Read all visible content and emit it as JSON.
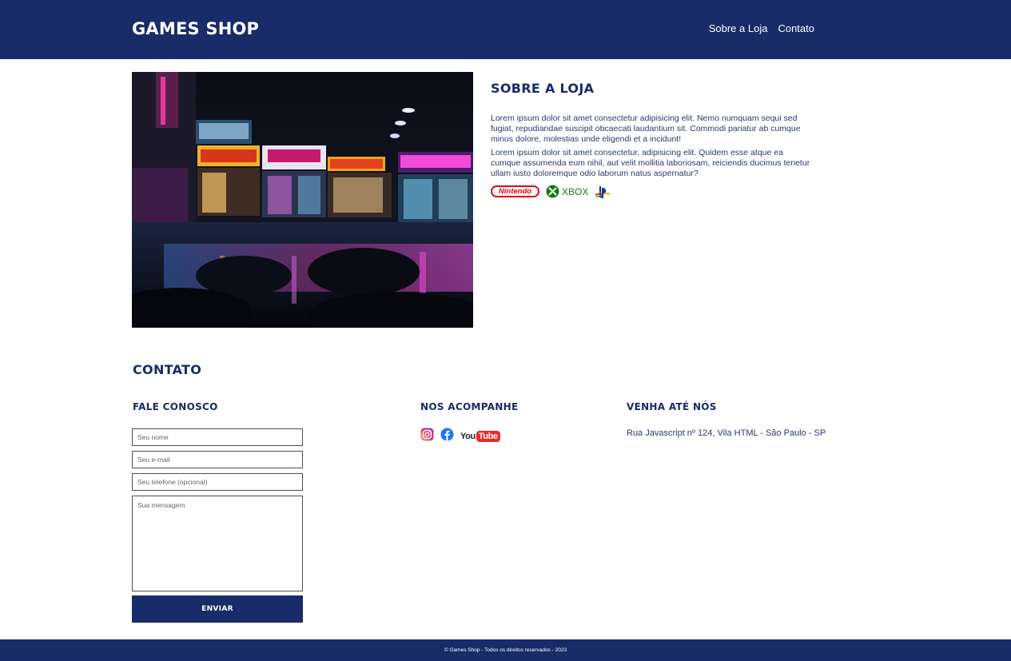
{
  "header": {
    "logo": "GAMES SHOP",
    "nav": [
      {
        "label": "Sobre a Loja"
      },
      {
        "label": "Contato"
      }
    ]
  },
  "about": {
    "title": "SOBRE A LOJA",
    "paragraphs": [
      "Lorem ipsum dolor sit amet consectetur adipisicing elit. Nemo numquam sequi sed fugiat, repudiandae suscipit obcaecati laudantium sit. Commodi pariatur ab cumque minus dolore, molestias unde eligendi et a incidunt!",
      "Lorem ipsum dolor sit amet consectetur, adipisicing elit. Quidem esse atque ea cumque assumenda eum nihil, aut velit mollitia laboriosam, reiciendis ducimus tenetur ullam iusto doloremque odio laborum natus aspernatur?"
    ],
    "brands": {
      "nintendo": "Nintendo",
      "xbox": "XBOX"
    }
  },
  "contact": {
    "title": "CONTATO",
    "form": {
      "title": "FALE CONOSCO",
      "name_placeholder": "Seu nome",
      "email_placeholder": "Seu e-mail",
      "phone_placeholder": "Seu telefone (opcional)",
      "message_placeholder": "Sua mensagem",
      "submit_label": "ENVIAR"
    },
    "social": {
      "title": "NOS ACOMPANHE",
      "youtube_you": "You",
      "youtube_tube": "Tube"
    },
    "location": {
      "title": "VENHA ATÉ NÓS",
      "address": "Rua Javascript nº 124, Vila HTML - São Paulo - SP"
    }
  },
  "footer": {
    "copyright": "© Games Shop - Todos os direitos reservados - 2023"
  },
  "colors": {
    "brand": "#192b68",
    "background": "#ffffff"
  }
}
